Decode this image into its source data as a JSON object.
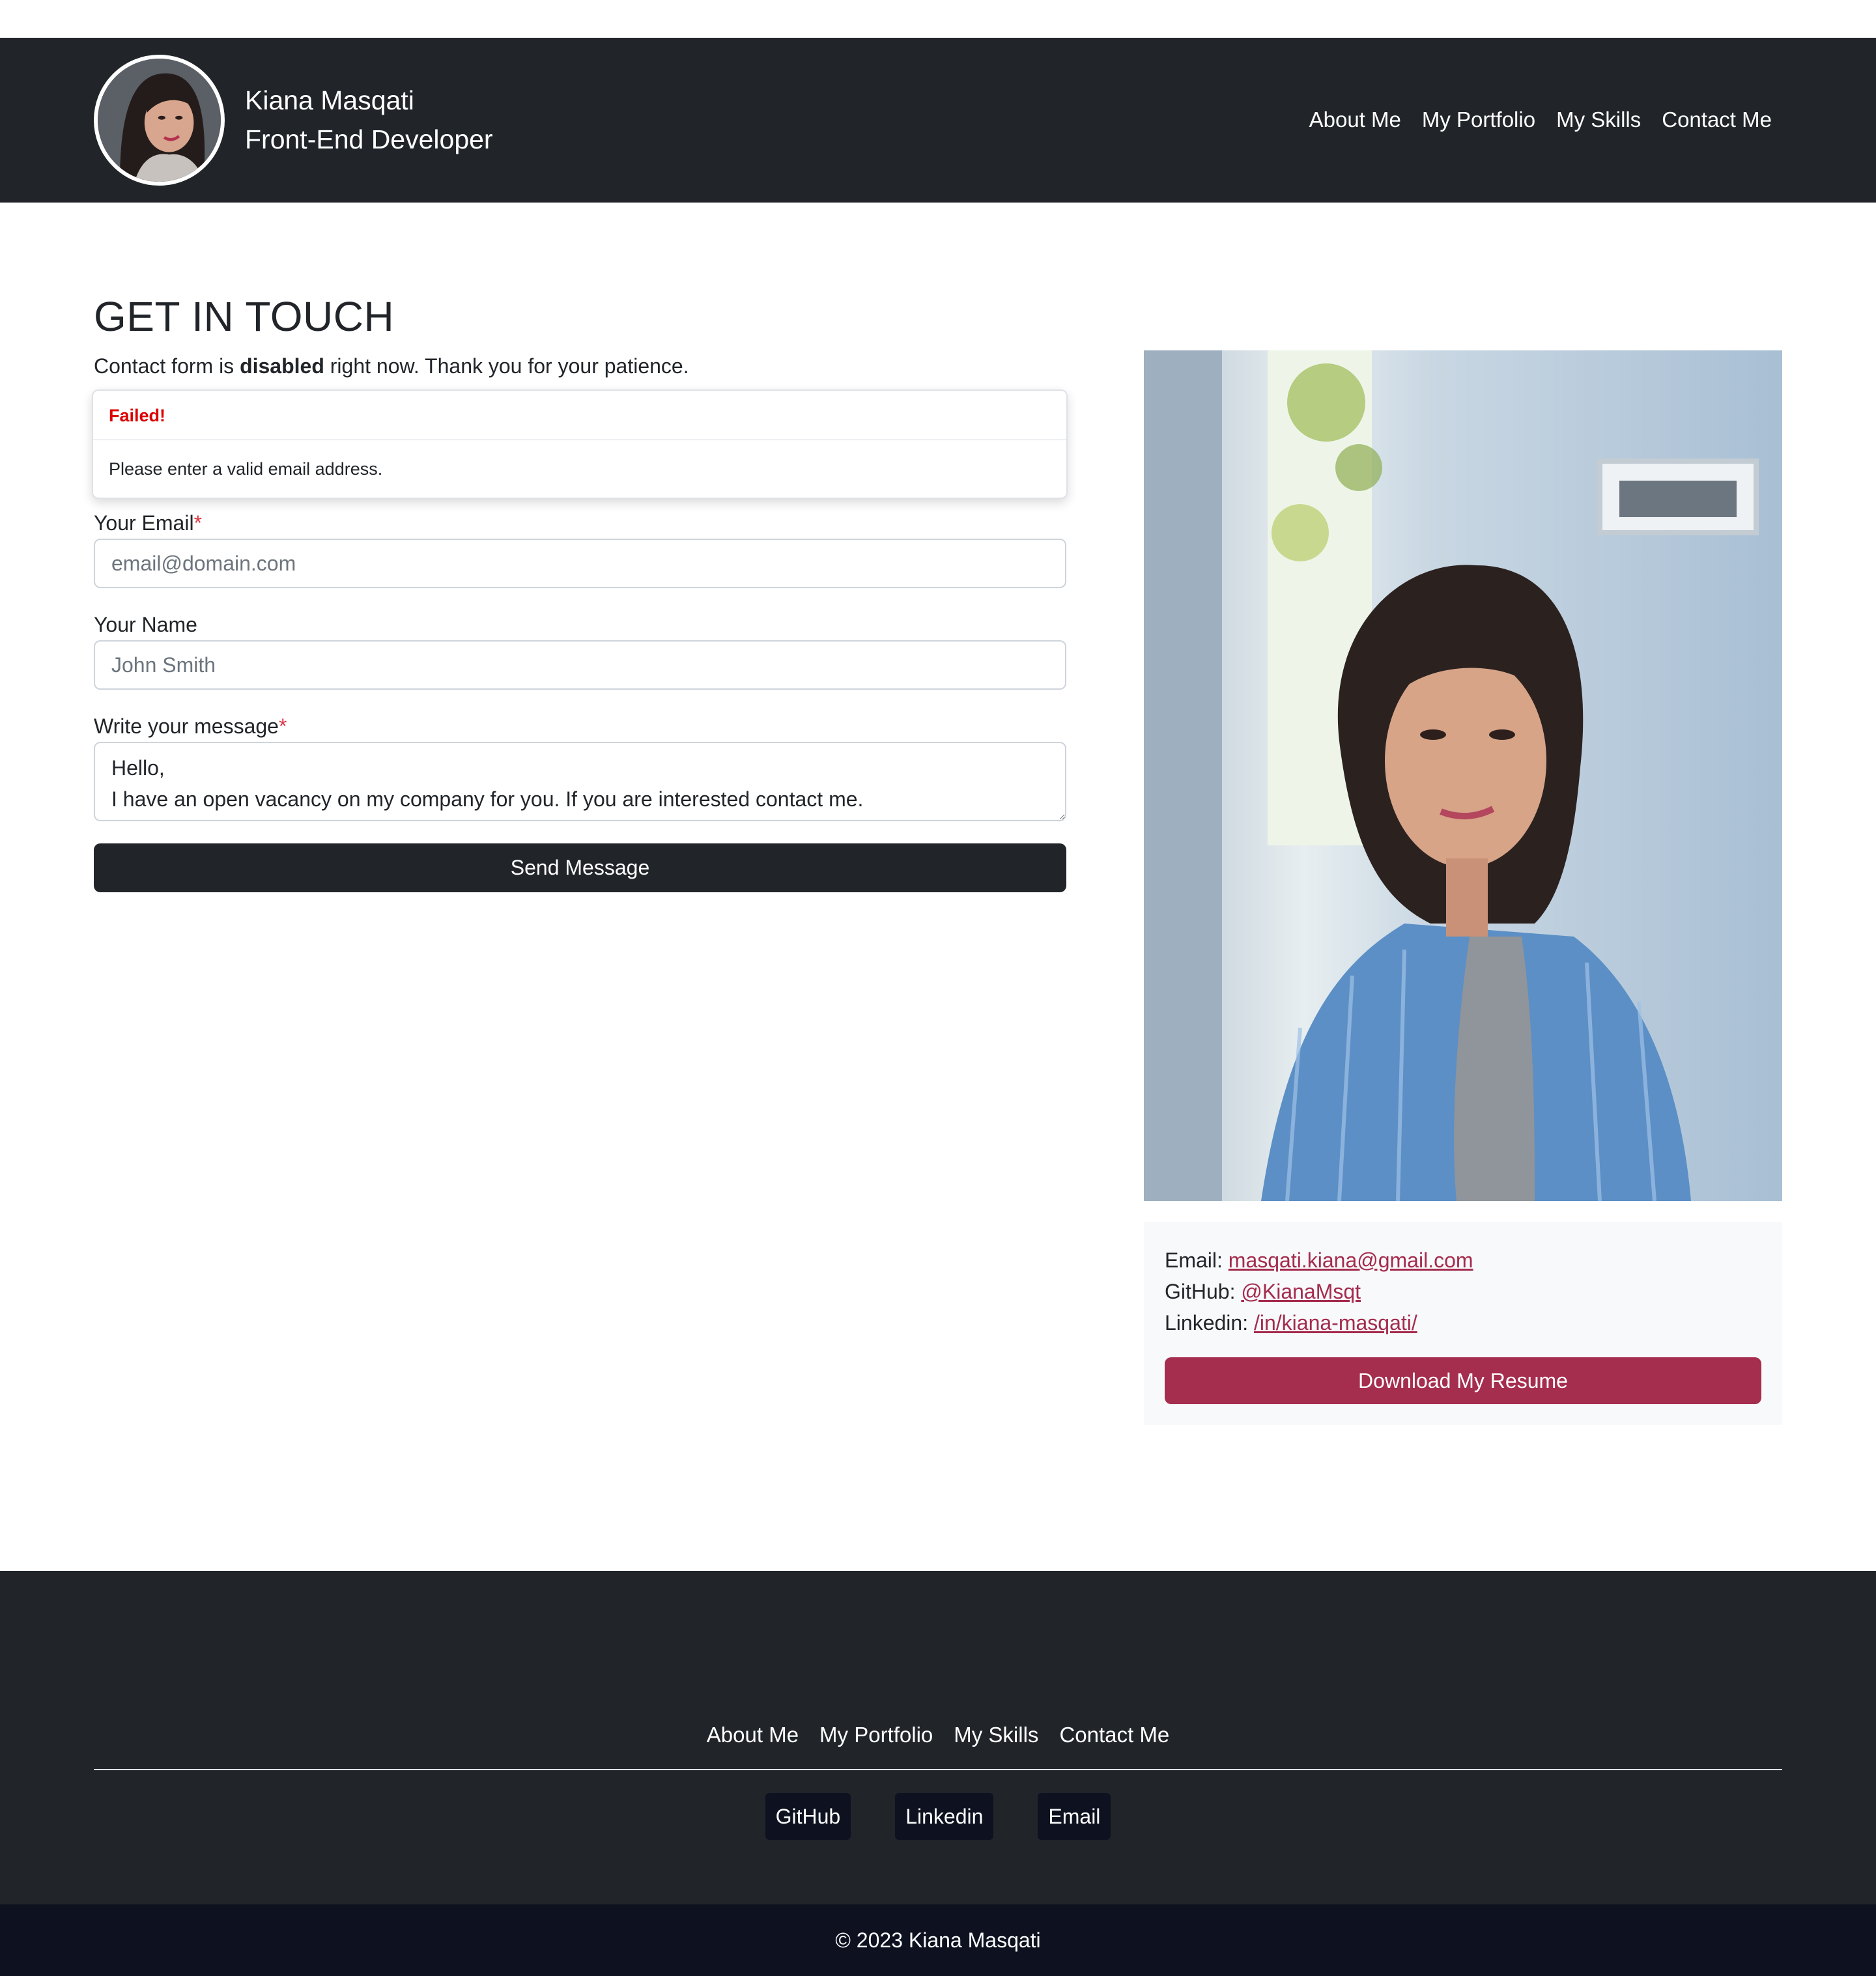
{
  "header": {
    "name": "Kiana Masqati",
    "role": "Front-End Developer",
    "nav": [
      "About Me",
      "My Portfolio",
      "My Skills",
      "Contact Me"
    ]
  },
  "main": {
    "title": "GET IN TOUCH",
    "lead_prefix": "Contact form is ",
    "lead_bold": "disabled",
    "lead_suffix": " right now. Thank you for your patience.",
    "toast": {
      "title": "Failed!",
      "message": "Please enter a valid email address."
    },
    "form": {
      "email_label": "Your Email",
      "email_placeholder": "email@domain.com",
      "name_label": "Your Name",
      "name_placeholder": "John Smith",
      "message_label": "Write your message",
      "message_value": "Hello,\nI have an open vacancy on my company for you. If you are interested contact me.",
      "required_mark": "*",
      "send_label": "Send Message"
    }
  },
  "contact_card": {
    "email_label": "Email: ",
    "email_value": "masqati.kiana@gmail.com",
    "github_label": "GitHub: ",
    "github_value": "@KianaMsqt",
    "linkedin_label": "Linkedin: ",
    "linkedin_value": "/in/kiana-masqati/",
    "resume_label": "Download My Resume"
  },
  "footer": {
    "nav": [
      "About Me",
      "My Portfolio",
      "My Skills",
      "Contact Me"
    ],
    "social": [
      "GitHub",
      "Linkedin",
      "Email"
    ],
    "copyright": "© 2023 Kiana Masqati"
  },
  "colors": {
    "header_bg": "#212529",
    "accent": "#a52d4d",
    "error": "#dc0000",
    "copyright_bg": "#0e1220"
  }
}
